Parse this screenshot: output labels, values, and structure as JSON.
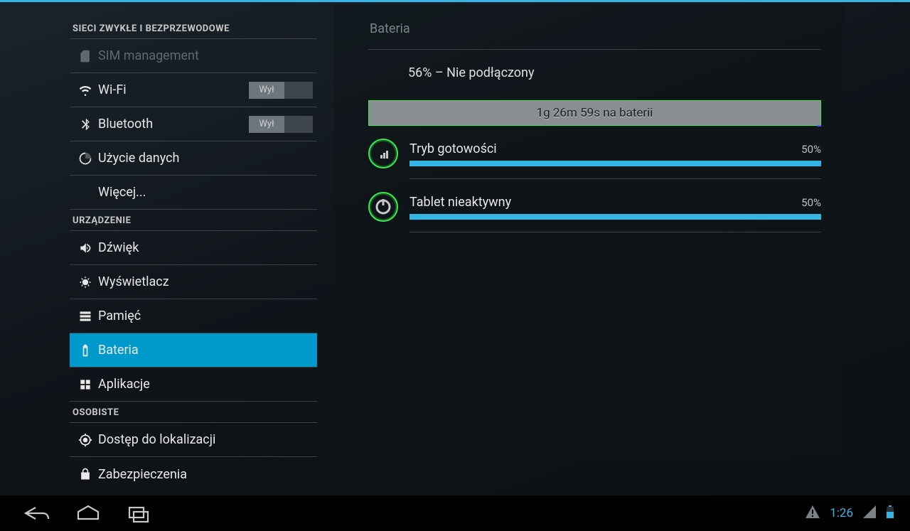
{
  "colors": {
    "accent": "#33b5e5",
    "selected": "#0099cc",
    "green": "#3bea52"
  },
  "sidebar": {
    "section1_title": "SIECI ZWYKŁE I BEZPRZEWODOWE",
    "section2_title": "URZĄDZENIE",
    "section3_title": "OSOBISTE",
    "sim_label": "SIM management",
    "wifi_label": "Wi-Fi",
    "bluetooth_label": "Bluetooth",
    "datausage_label": "Użycie danych",
    "more_label": "Więcej...",
    "sound_label": "Dźwięk",
    "display_label": "Wyświetlacz",
    "storage_label": "Pamięć",
    "battery_label": "Bateria",
    "apps_label": "Aplikacje",
    "location_label": "Dostęp do lokalizacji",
    "security_label": "Zabezpieczenia",
    "toggle_off": "Wył",
    "wifi_state": "Wył",
    "bt_state": "Wył"
  },
  "main": {
    "title": "Bateria",
    "status": "56% – Nie podłączony",
    "discharge_label": "1g 26m 59s na baterii",
    "items": [
      {
        "name": "Tryb gotowości",
        "pct_text": "50%",
        "pct": 100
      },
      {
        "name": "Tablet nieaktywny",
        "pct_text": "50%",
        "pct": 100
      }
    ]
  },
  "statusbar": {
    "clock": "1:26"
  }
}
